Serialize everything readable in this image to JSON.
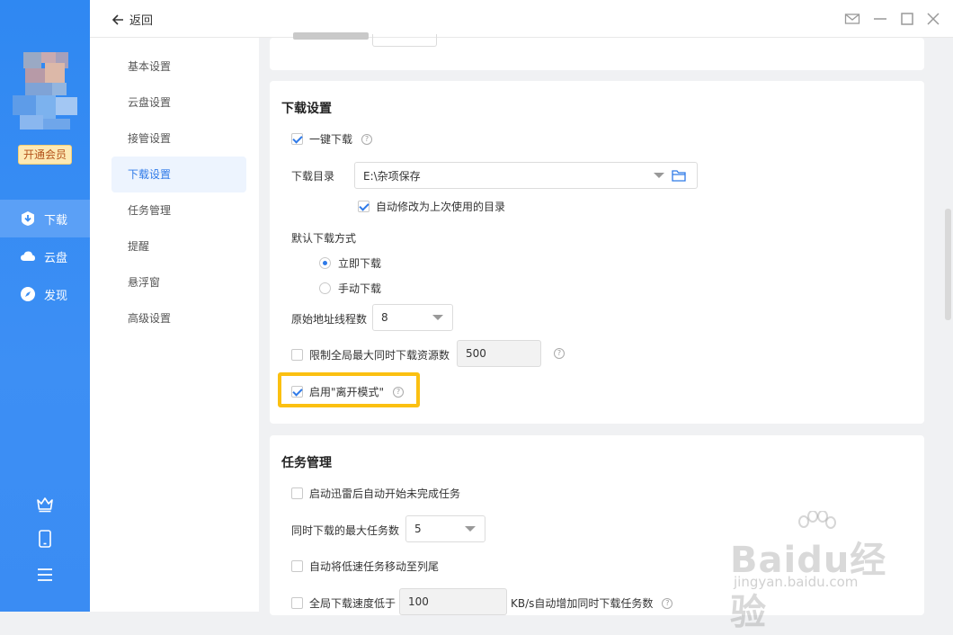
{
  "sidebar": {
    "vip_label": "开通会员",
    "nav": [
      {
        "label": "下载",
        "icon": "download-icon",
        "active": true
      },
      {
        "label": "云盘",
        "icon": "cloud-icon",
        "active": false
      },
      {
        "label": "发现",
        "icon": "compass-icon",
        "active": false
      }
    ],
    "bottom_icons": [
      "crown-icon",
      "phone-icon",
      "menu-icon"
    ]
  },
  "topbar": {
    "back_label": "返回",
    "window_controls": [
      "mail-icon",
      "minimize-icon",
      "maximize-icon",
      "close-icon"
    ]
  },
  "settings_nav": [
    {
      "label": "基本设置",
      "active": false
    },
    {
      "label": "云盘设置",
      "active": false
    },
    {
      "label": "接管设置",
      "active": false
    },
    {
      "label": "下载设置",
      "active": true
    },
    {
      "label": "任务管理",
      "active": false
    },
    {
      "label": "提醒",
      "active": false
    },
    {
      "label": "悬浮窗",
      "active": false
    },
    {
      "label": "高级设置",
      "active": false
    }
  ],
  "download_settings": {
    "title": "下载设置",
    "one_click_label": "一键下载",
    "one_click_checked": true,
    "dir_label": "下载目录",
    "dir_value": "E:\\杂项保存",
    "auto_modify_label": "自动修改为上次使用的目录",
    "auto_modify_checked": true,
    "default_mode_label": "默认下载方式",
    "mode_immediate": "立即下载",
    "mode_manual": "手动下载",
    "mode_selected": "立即下载",
    "threads_label": "原始地址线程数",
    "threads_value": "8",
    "limit_label": "限制全局最大同时下载资源数",
    "limit_checked": false,
    "limit_value": "500",
    "leave_mode_label": "启用\"离开模式\"",
    "leave_mode_checked": true
  },
  "task_settings": {
    "title": "任务管理",
    "auto_start_label": "启动迅雷后自动开始未完成任务",
    "auto_start_checked": false,
    "max_tasks_label": "同时下载的最大任务数",
    "max_tasks_value": "5",
    "move_slow_label": "自动将低速任务移动至列尾",
    "move_slow_checked": false,
    "speed_prefix": "全局下载速度低于",
    "speed_value": "100",
    "speed_suffix": "KB/s自动增加同时下载任务数",
    "speed_checked": false
  },
  "watermark": {
    "text": "Baidu经验",
    "sub": "jingyan.baidu.com"
  },
  "colors": {
    "sidebar": "#2f88f2",
    "accent": "#2f7ae8",
    "highlight": "#fbc011"
  }
}
